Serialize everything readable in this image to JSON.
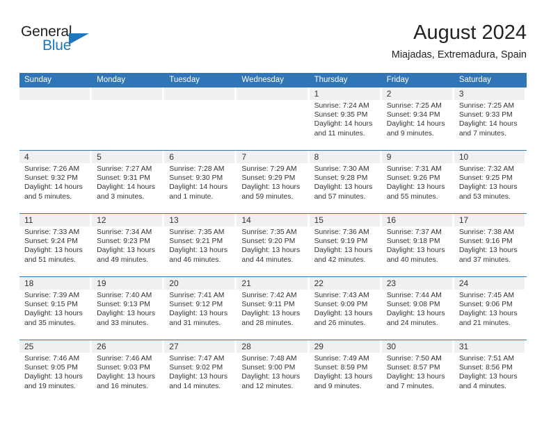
{
  "brand": {
    "name_primary": "General",
    "name_secondary": "Blue",
    "primary_color": "#231f20",
    "secondary_color": "#1f76bc"
  },
  "header": {
    "title": "August 2024",
    "subtitle": "Miajadas, Extremadura, Spain"
  },
  "theme": {
    "header_blue": "#3075b6",
    "date_band": "#f0f0f0",
    "text": "#333333"
  },
  "weekday_headers": [
    "Sunday",
    "Monday",
    "Tuesday",
    "Wednesday",
    "Thursday",
    "Friday",
    "Saturday"
  ],
  "weeks": [
    [
      {
        "day": "",
        "sunrise": "",
        "sunset": "",
        "daylight": "",
        "empty": true
      },
      {
        "day": "",
        "sunrise": "",
        "sunset": "",
        "daylight": "",
        "empty": true
      },
      {
        "day": "",
        "sunrise": "",
        "sunset": "",
        "daylight": "",
        "empty": true
      },
      {
        "day": "",
        "sunrise": "",
        "sunset": "",
        "daylight": "",
        "empty": true
      },
      {
        "day": "1",
        "sunrise": "Sunrise: 7:24 AM",
        "sunset": "Sunset: 9:35 PM",
        "daylight": "Daylight: 14 hours and 11 minutes.",
        "empty": false
      },
      {
        "day": "2",
        "sunrise": "Sunrise: 7:25 AM",
        "sunset": "Sunset: 9:34 PM",
        "daylight": "Daylight: 14 hours and 9 minutes.",
        "empty": false
      },
      {
        "day": "3",
        "sunrise": "Sunrise: 7:25 AM",
        "sunset": "Sunset: 9:33 PM",
        "daylight": "Daylight: 14 hours and 7 minutes.",
        "empty": false
      }
    ],
    [
      {
        "day": "4",
        "sunrise": "Sunrise: 7:26 AM",
        "sunset": "Sunset: 9:32 PM",
        "daylight": "Daylight: 14 hours and 5 minutes.",
        "empty": false
      },
      {
        "day": "5",
        "sunrise": "Sunrise: 7:27 AM",
        "sunset": "Sunset: 9:31 PM",
        "daylight": "Daylight: 14 hours and 3 minutes.",
        "empty": false
      },
      {
        "day": "6",
        "sunrise": "Sunrise: 7:28 AM",
        "sunset": "Sunset: 9:30 PM",
        "daylight": "Daylight: 14 hours and 1 minute.",
        "empty": false
      },
      {
        "day": "7",
        "sunrise": "Sunrise: 7:29 AM",
        "sunset": "Sunset: 9:29 PM",
        "daylight": "Daylight: 13 hours and 59 minutes.",
        "empty": false
      },
      {
        "day": "8",
        "sunrise": "Sunrise: 7:30 AM",
        "sunset": "Sunset: 9:28 PM",
        "daylight": "Daylight: 13 hours and 57 minutes.",
        "empty": false
      },
      {
        "day": "9",
        "sunrise": "Sunrise: 7:31 AM",
        "sunset": "Sunset: 9:26 PM",
        "daylight": "Daylight: 13 hours and 55 minutes.",
        "empty": false
      },
      {
        "day": "10",
        "sunrise": "Sunrise: 7:32 AM",
        "sunset": "Sunset: 9:25 PM",
        "daylight": "Daylight: 13 hours and 53 minutes.",
        "empty": false
      }
    ],
    [
      {
        "day": "11",
        "sunrise": "Sunrise: 7:33 AM",
        "sunset": "Sunset: 9:24 PM",
        "daylight": "Daylight: 13 hours and 51 minutes.",
        "empty": false
      },
      {
        "day": "12",
        "sunrise": "Sunrise: 7:34 AM",
        "sunset": "Sunset: 9:23 PM",
        "daylight": "Daylight: 13 hours and 49 minutes.",
        "empty": false
      },
      {
        "day": "13",
        "sunrise": "Sunrise: 7:35 AM",
        "sunset": "Sunset: 9:21 PM",
        "daylight": "Daylight: 13 hours and 46 minutes.",
        "empty": false
      },
      {
        "day": "14",
        "sunrise": "Sunrise: 7:35 AM",
        "sunset": "Sunset: 9:20 PM",
        "daylight": "Daylight: 13 hours and 44 minutes.",
        "empty": false
      },
      {
        "day": "15",
        "sunrise": "Sunrise: 7:36 AM",
        "sunset": "Sunset: 9:19 PM",
        "daylight": "Daylight: 13 hours and 42 minutes.",
        "empty": false
      },
      {
        "day": "16",
        "sunrise": "Sunrise: 7:37 AM",
        "sunset": "Sunset: 9:18 PM",
        "daylight": "Daylight: 13 hours and 40 minutes.",
        "empty": false
      },
      {
        "day": "17",
        "sunrise": "Sunrise: 7:38 AM",
        "sunset": "Sunset: 9:16 PM",
        "daylight": "Daylight: 13 hours and 37 minutes.",
        "empty": false
      }
    ],
    [
      {
        "day": "18",
        "sunrise": "Sunrise: 7:39 AM",
        "sunset": "Sunset: 9:15 PM",
        "daylight": "Daylight: 13 hours and 35 minutes.",
        "empty": false
      },
      {
        "day": "19",
        "sunrise": "Sunrise: 7:40 AM",
        "sunset": "Sunset: 9:13 PM",
        "daylight": "Daylight: 13 hours and 33 minutes.",
        "empty": false
      },
      {
        "day": "20",
        "sunrise": "Sunrise: 7:41 AM",
        "sunset": "Sunset: 9:12 PM",
        "daylight": "Daylight: 13 hours and 31 minutes.",
        "empty": false
      },
      {
        "day": "21",
        "sunrise": "Sunrise: 7:42 AM",
        "sunset": "Sunset: 9:11 PM",
        "daylight": "Daylight: 13 hours and 28 minutes.",
        "empty": false
      },
      {
        "day": "22",
        "sunrise": "Sunrise: 7:43 AM",
        "sunset": "Sunset: 9:09 PM",
        "daylight": "Daylight: 13 hours and 26 minutes.",
        "empty": false
      },
      {
        "day": "23",
        "sunrise": "Sunrise: 7:44 AM",
        "sunset": "Sunset: 9:08 PM",
        "daylight": "Daylight: 13 hours and 24 minutes.",
        "empty": false
      },
      {
        "day": "24",
        "sunrise": "Sunrise: 7:45 AM",
        "sunset": "Sunset: 9:06 PM",
        "daylight": "Daylight: 13 hours and 21 minutes.",
        "empty": false
      }
    ],
    [
      {
        "day": "25",
        "sunrise": "Sunrise: 7:46 AM",
        "sunset": "Sunset: 9:05 PM",
        "daylight": "Daylight: 13 hours and 19 minutes.",
        "empty": false
      },
      {
        "day": "26",
        "sunrise": "Sunrise: 7:46 AM",
        "sunset": "Sunset: 9:03 PM",
        "daylight": "Daylight: 13 hours and 16 minutes.",
        "empty": false
      },
      {
        "day": "27",
        "sunrise": "Sunrise: 7:47 AM",
        "sunset": "Sunset: 9:02 PM",
        "daylight": "Daylight: 13 hours and 14 minutes.",
        "empty": false
      },
      {
        "day": "28",
        "sunrise": "Sunrise: 7:48 AM",
        "sunset": "Sunset: 9:00 PM",
        "daylight": "Daylight: 13 hours and 12 minutes.",
        "empty": false
      },
      {
        "day": "29",
        "sunrise": "Sunrise: 7:49 AM",
        "sunset": "Sunset: 8:59 PM",
        "daylight": "Daylight: 13 hours and 9 minutes.",
        "empty": false
      },
      {
        "day": "30",
        "sunrise": "Sunrise: 7:50 AM",
        "sunset": "Sunset: 8:57 PM",
        "daylight": "Daylight: 13 hours and 7 minutes.",
        "empty": false
      },
      {
        "day": "31",
        "sunrise": "Sunrise: 7:51 AM",
        "sunset": "Sunset: 8:56 PM",
        "daylight": "Daylight: 13 hours and 4 minutes.",
        "empty": false
      }
    ]
  ]
}
